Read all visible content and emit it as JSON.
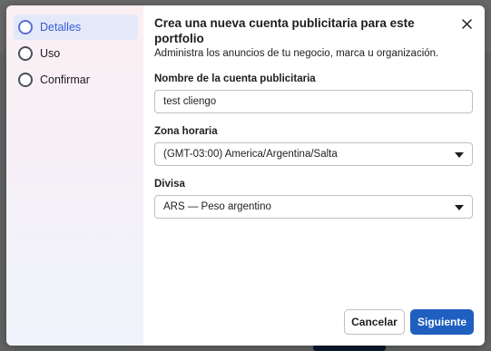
{
  "stepper": {
    "steps": [
      {
        "label": "Detalles",
        "active": true
      },
      {
        "label": "Uso",
        "active": false
      },
      {
        "label": "Confirmar",
        "active": false
      }
    ]
  },
  "dialog": {
    "title": "Crea una nueva cuenta publicitaria para este portfolio",
    "subtitle": "Administra los anuncios de tu negocio, marca u organización.",
    "close_icon": "close-icon"
  },
  "form": {
    "account_name": {
      "label": "Nombre de la cuenta publicitaria",
      "value": "test cliengo"
    },
    "timezone": {
      "label": "Zona horaria",
      "value": "(GMT-03:00) America/Argentina/Salta"
    },
    "currency": {
      "label": "Divisa",
      "value": "ARS — Peso argentino"
    }
  },
  "footer": {
    "cancel_label": "Cancelar",
    "next_label": "Siguiente"
  },
  "colors": {
    "primary": "#1f5fbf",
    "active_step": "#3b5bdb"
  }
}
